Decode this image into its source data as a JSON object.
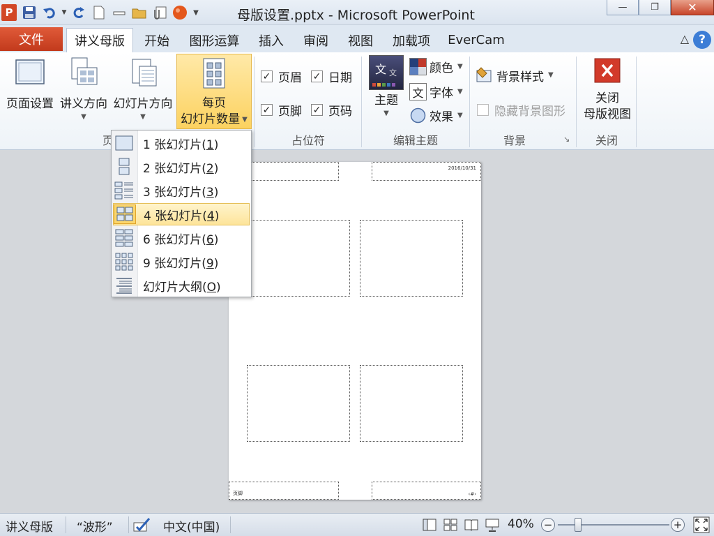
{
  "window": {
    "title": "母版设置.pptx  -  Microsoft PowerPoint",
    "app_logo": "P",
    "minimize": "—",
    "restore": "❐",
    "close": "✕"
  },
  "tabs": {
    "file": "文件",
    "items": [
      "讲义母版",
      "开始",
      "图形运算",
      "插入",
      "审阅",
      "视图",
      "加载项",
      "EverCam"
    ],
    "help": "?",
    "minimize_ribbon": "△"
  },
  "ribbon": {
    "page_setup": "页面设置",
    "handout_orientation": "讲义方向",
    "slide_orientation": "幻灯片方向",
    "slides_per_page_l1": "每页",
    "slides_per_page_l2": "幻灯片数量",
    "group_page_setup": "页",
    "header": "页眉",
    "date": "日期",
    "footer": "页脚",
    "page_number": "页码",
    "group_placeholders": "占位符",
    "themes": "主题",
    "colors": "颜色",
    "fonts": "字体",
    "effects": "效果",
    "theme_glyph_1": "文",
    "theme_glyph_2": "文",
    "font_glyph": "文",
    "group_edit_theme": "编辑主题",
    "background_styles": "背景样式",
    "hide_background": "隐藏背景图形",
    "group_background": "背景",
    "close_master_l1": "关闭",
    "close_master_l2": "母版视图",
    "group_close": "关闭",
    "check_mark": "✓"
  },
  "dropdown": {
    "items": [
      {
        "num": "1 张幻灯片(",
        "key": "1",
        "end": ")"
      },
      {
        "num": "2 张幻灯片(",
        "key": "2",
        "end": ")"
      },
      {
        "num": "3 张幻灯片(",
        "key": "3",
        "end": ")"
      },
      {
        "num": "4 张幻灯片(",
        "key": "4",
        "end": ")"
      },
      {
        "num": "6 张幻灯片(",
        "key": "6",
        "end": ")"
      },
      {
        "num": "9 张幻灯片(",
        "key": "9",
        "end": ")"
      },
      {
        "num": "幻灯片大纲(",
        "key": "O",
        "end": ")"
      }
    ],
    "selected_index": 3
  },
  "handout": {
    "date_text": "2016/10/31",
    "footer_text": "页脚",
    "page_num_text": "‹#›"
  },
  "status": {
    "view": "讲义母版",
    "theme": "“波形”",
    "language": "中文(中国)",
    "zoom": "40%",
    "zoom_minus": "−",
    "zoom_plus": "+",
    "zoom_fraction": 0.18
  },
  "colors": {
    "file_tab": "#c7401f",
    "highlight": "#fcd260",
    "close_button": "#c8452a"
  }
}
